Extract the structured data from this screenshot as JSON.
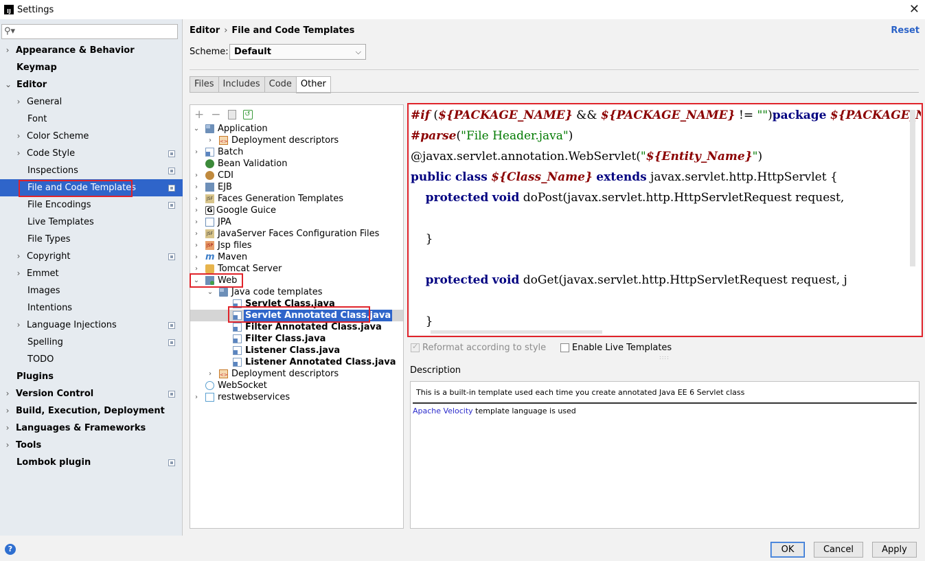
{
  "window": {
    "title": "Settings",
    "app_icon": "IJ"
  },
  "search": {
    "placeholder": ""
  },
  "sidebar": {
    "items": [
      {
        "label": "Appearance & Behavior",
        "arrow": "›"
      },
      {
        "label": "Keymap"
      },
      {
        "label": "Editor",
        "arrow": "⌄"
      },
      {
        "label": "General",
        "arrow": "›"
      },
      {
        "label": "Font"
      },
      {
        "label": "Color Scheme",
        "arrow": "›"
      },
      {
        "label": "Code Style",
        "arrow": "›"
      },
      {
        "label": "Inspections"
      },
      {
        "label": "File and Code Templates",
        "selected": true
      },
      {
        "label": "File Encodings"
      },
      {
        "label": "Live Templates"
      },
      {
        "label": "File Types"
      },
      {
        "label": "Copyright",
        "arrow": "›"
      },
      {
        "label": "Emmet",
        "arrow": "›"
      },
      {
        "label": "Images"
      },
      {
        "label": "Intentions"
      },
      {
        "label": "Language Injections",
        "arrow": "›"
      },
      {
        "label": "Spelling"
      },
      {
        "label": "TODO"
      },
      {
        "label": "Plugins"
      },
      {
        "label": "Version Control",
        "arrow": "›"
      },
      {
        "label": "Build, Execution, Deployment",
        "arrow": "›"
      },
      {
        "label": "Languages & Frameworks",
        "arrow": "›"
      },
      {
        "label": "Tools",
        "arrow": "›"
      },
      {
        "label": "Lombok plugin"
      }
    ]
  },
  "header": {
    "breadcrumb_parent": "Editor",
    "breadcrumb_sep": "›",
    "breadcrumb_current": "File and Code Templates",
    "reset_label": "Reset",
    "scheme_label": "Scheme:",
    "scheme_value": "Default",
    "scheme_chevron": "⌵"
  },
  "tabs": [
    "Files",
    "Includes",
    "Code",
    "Other"
  ],
  "toolbar": {
    "add": "+",
    "remove": "−"
  },
  "template_tree": [
    {
      "label": "Application"
    },
    {
      "label": "Deployment descriptors"
    },
    {
      "label": "Batch"
    },
    {
      "label": "Bean Validation"
    },
    {
      "label": "CDI"
    },
    {
      "label": "EJB"
    },
    {
      "label": "Faces Generation Templates"
    },
    {
      "label": "Google Guice"
    },
    {
      "label": "JPA"
    },
    {
      "label": "JavaServer Faces Configuration Files"
    },
    {
      "label": "Jsp files"
    },
    {
      "label": "Maven"
    },
    {
      "label": "Tomcat Server"
    },
    {
      "label": "Web"
    },
    {
      "label": "Java code templates"
    },
    {
      "label": "Servlet Class.java"
    },
    {
      "label": "Servlet Annotated Class.java"
    },
    {
      "label": "Filter Annotated Class.java"
    },
    {
      "label": "Filter Class.java"
    },
    {
      "label": "Listener Class.java"
    },
    {
      "label": "Listener Annotated Class.java"
    },
    {
      "label": "Deployment descriptors"
    },
    {
      "label": "WebSocket"
    },
    {
      "label": "restwebservices"
    }
  ],
  "editor": {
    "line1": {
      "a": "#if",
      "b": " (",
      "c": "${PACKAGE_NAME}",
      "d": " && ",
      "e": "${PACKAGE_NAME}",
      "f": " != ",
      "g": "\"\"",
      "h": ")",
      "i": "package",
      "j": " ",
      "k": "${PACKAGE_NAME}"
    },
    "line2": {
      "a": "#parse",
      "b": "(",
      "c": "\"File Header.java\"",
      "d": ")"
    },
    "line3": {
      "a": "@javax.servlet.annotation.WebServlet(",
      "b": "\"",
      "c": "${Entity_Name}",
      "d": "\"",
      "e": ")"
    },
    "line4": {
      "a": "public",
      "b": " ",
      "c": "class",
      "d": " ",
      "e": "${Class_Name}",
      "f": " ",
      "g": "extends",
      "h": " javax.servlet.http.HttpServlet {"
    },
    "line5": {
      "a": "    ",
      "b": "protected",
      "c": " ",
      "d": "void",
      "e": " doPost(javax.servlet.http.HttpServletRequest request,"
    },
    "line6": {
      "a": "    }"
    },
    "line7": {
      "a": "    ",
      "b": "protected",
      "c": " ",
      "d": "void",
      "e": " doGet(javax.servlet.http.HttpServletRequest request, j"
    },
    "line8": {
      "a": "    }"
    }
  },
  "options": {
    "reformat_label": "Reformat according to style",
    "reformat_checked": true,
    "reformat_disabled": true,
    "live_templates_label": "Enable Live Templates",
    "live_templates_checked": false
  },
  "description": {
    "label": "Description",
    "line1": "This is a built-in template used each time you create annotated Java EE 6 Servlet class",
    "link": "Apache Velocity",
    "line2_rest": " template language is used"
  },
  "buttons": {
    "ok": "OK",
    "cancel": "Cancel",
    "apply": "Apply",
    "help": "?"
  },
  "colors": {
    "selection": "#2f65ca",
    "highlight_box": "#e0232a",
    "link": "#2a62c7"
  }
}
